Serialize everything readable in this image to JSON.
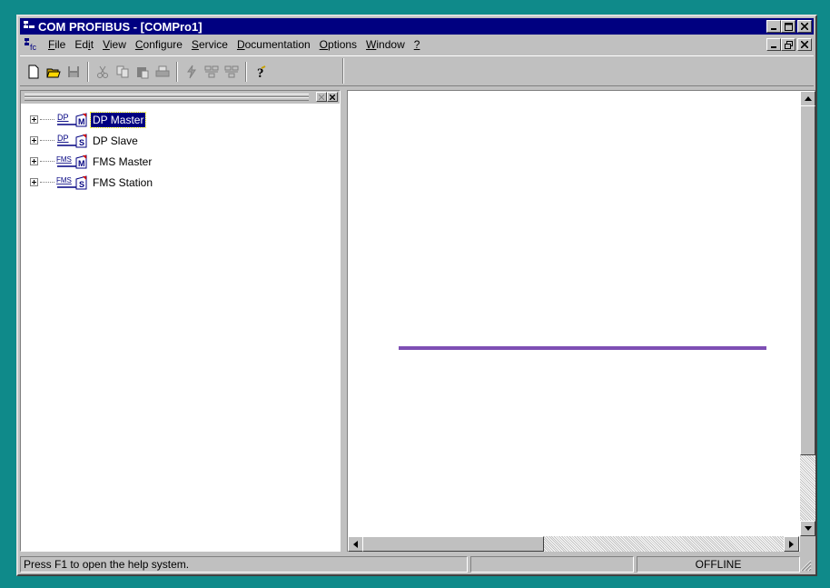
{
  "window": {
    "title": "COM PROFIBUS - [COMPro1]"
  },
  "menu": {
    "items": [
      {
        "label": "File",
        "accel": "F"
      },
      {
        "label": "Edit",
        "accel": "i"
      },
      {
        "label": "View",
        "accel": "V"
      },
      {
        "label": "Configure",
        "accel": "C"
      },
      {
        "label": "Service",
        "accel": "S"
      },
      {
        "label": "Documentation",
        "accel": "D"
      },
      {
        "label": "Options",
        "accel": "O"
      },
      {
        "label": "Window",
        "accel": "W"
      },
      {
        "label": "?",
        "accel": "?"
      }
    ]
  },
  "toolbar": {
    "buttons": [
      "new-icon",
      "open-icon",
      "save-icon",
      "cut-icon",
      "copy-icon",
      "paste-icon",
      "print-icon",
      "bus-param-icon",
      "station-icon",
      "station2-icon",
      "help-icon"
    ]
  },
  "tree": {
    "items": [
      {
        "icon_text": "DP",
        "icon_sub": "M",
        "label": "DP Master",
        "selected": true
      },
      {
        "icon_text": "DP",
        "icon_sub": "S",
        "label": "DP Slave",
        "selected": false
      },
      {
        "icon_text": "FMS",
        "icon_sub": "M",
        "label": "FMS Master",
        "selected": false
      },
      {
        "icon_text": "FMS",
        "icon_sub": "S",
        "label": "FMS Station",
        "selected": false
      }
    ]
  },
  "canvas": {
    "bus_color": "#7e4fb4"
  },
  "status": {
    "message": "Press F1 to open the help system.",
    "middle": "",
    "mode": "OFFLINE"
  },
  "colors": {
    "titlebar": "#000080",
    "desktop": "#0f8a8a",
    "face": "#c0c0c0"
  }
}
